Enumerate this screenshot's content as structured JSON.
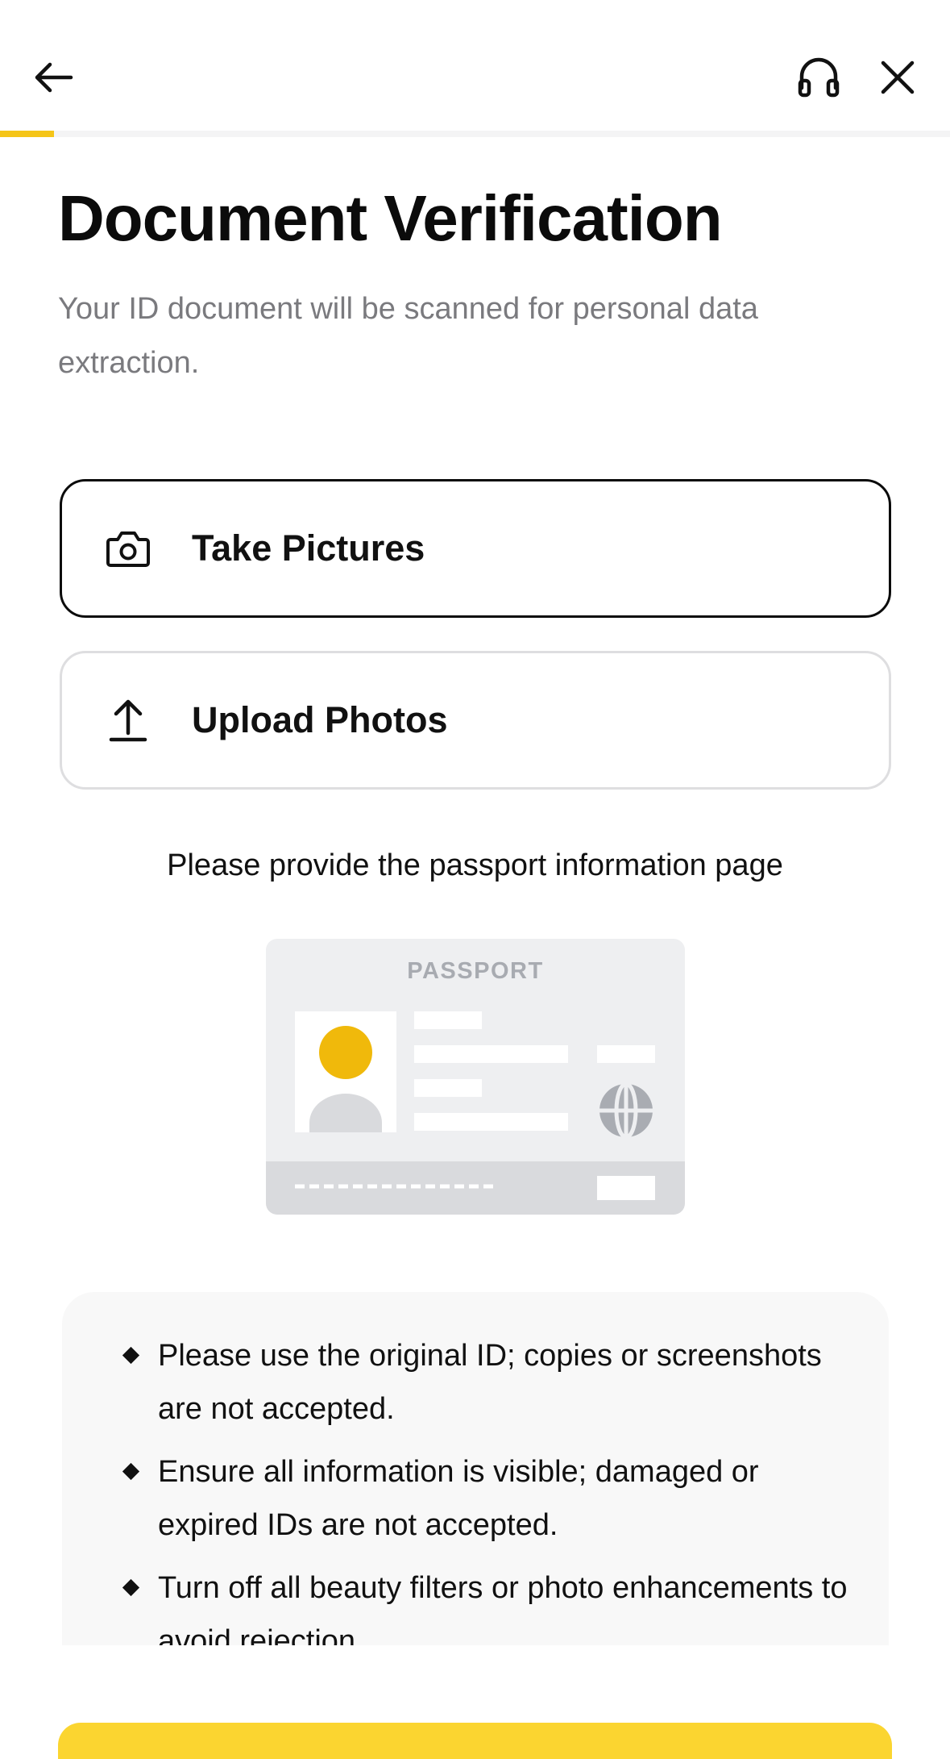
{
  "header": {
    "back_icon": "arrow-left-icon",
    "support_icon": "headphones-icon",
    "close_icon": "close-icon",
    "progress": 0.057,
    "accent_color": "#f5c518"
  },
  "title": "Document Verification",
  "subtitle": "Your ID document will be scanned for personal data extraction.",
  "options": {
    "take_pictures": {
      "label": "Take Pictures",
      "icon": "camera-icon"
    },
    "upload_photos": {
      "label": "Upload Photos",
      "icon": "upload-icon"
    }
  },
  "instruction": "Please provide the passport information page",
  "passport": {
    "label": "PASSPORT"
  },
  "tips": [
    "Please use the original ID; copies or screenshots are not accepted.",
    "Ensure all information is visible; damaged or expired IDs are not accepted.",
    "Turn off all beauty filters or photo enhancements to avoid rejection."
  ],
  "cta": {
    "color": "#fbd530"
  }
}
